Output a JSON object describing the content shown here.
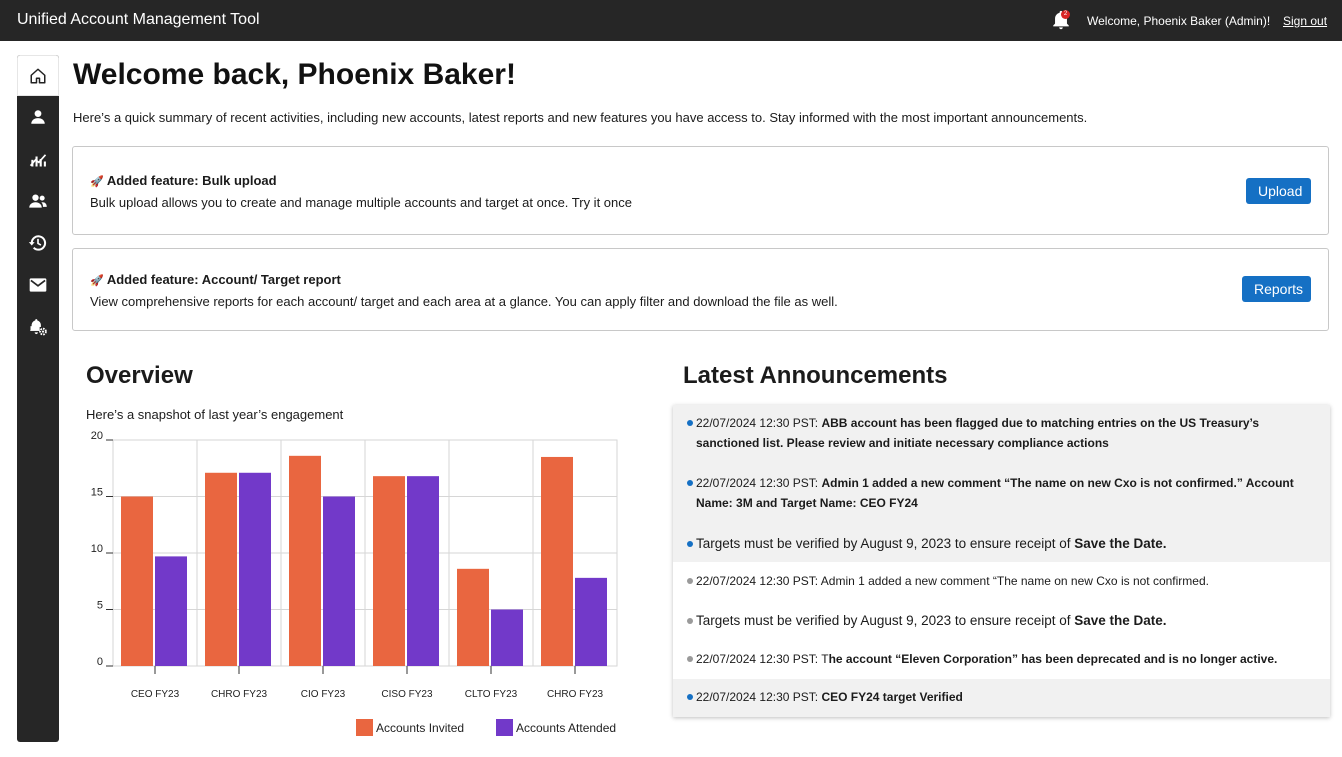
{
  "header": {
    "app_title": "Unified Account Management Tool",
    "notification_count": "2",
    "welcome_text": "Welcome, Phoenix Baker (Admin)!",
    "sign_out_label": "Sign out"
  },
  "sidebar": {
    "items": [
      {
        "icon": "home-icon"
      },
      {
        "icon": "person-icon"
      },
      {
        "icon": "analytics-icon"
      },
      {
        "icon": "group-icon"
      },
      {
        "icon": "history-icon"
      },
      {
        "icon": "mail-icon"
      },
      {
        "icon": "notification-settings-icon"
      }
    ]
  },
  "main": {
    "title": "Welcome back, Phoenix Baker!",
    "intro": "Here’s a quick summary of recent activities, including new accounts, latest reports and new features you have access to. Stay informed with the most important announcements.",
    "features": [
      {
        "icon": "🚀",
        "title": "Added feature: Bulk upload",
        "description": "Bulk upload allows you to create and manage multiple accounts and target at once. Try it once",
        "button_label": "Upload"
      },
      {
        "icon": "🚀",
        "title": "Added feature: Account/ Target report",
        "description": "View comprehensive reports for each account/ target and each area at a glance. You can apply filter and download the file as well.",
        "button_label": "Reports"
      }
    ]
  },
  "overview": {
    "heading": "Overview",
    "subheading": "Here’s a snapshot of last year’s engagement"
  },
  "chart_data": {
    "type": "bar",
    "categories": [
      "CEO FY23",
      "CHRO FY23",
      "CIO FY23",
      "CISO FY23",
      "CLTO FY23",
      "CHRO FY23"
    ],
    "series": [
      {
        "name": "Accounts Invited",
        "values": [
          15,
          17.1,
          18.6,
          16.8,
          8.6,
          18.5
        ]
      },
      {
        "name": "Accounts Attended",
        "values": [
          9.7,
          17.1,
          15,
          16.8,
          5,
          7.8
        ]
      }
    ],
    "colors": [
      "#e96640",
      "#7239c9"
    ],
    "ylim": [
      0,
      20
    ],
    "yticks": [
      0,
      5,
      10,
      15,
      20
    ],
    "grid": true,
    "legend": "bottom-right",
    "title": "",
    "xlabel": "",
    "ylabel": ""
  },
  "announcements": {
    "heading": "Latest Announcements",
    "items": [
      {
        "date": "22/07/2024 12:30 PST:",
        "text": "ABB account has been flagged due to matching entries on the US Treasury’s sanctioned list. Please review and initiate necessary compliance actions",
        "status": "new",
        "size": "small"
      },
      {
        "date": "22/07/2024 12:30 PST:",
        "text": "Admin 1 added a new comment “The name on new Cxo is not confirmed.” Account Name: 3M and Target Name: CEO FY24",
        "status": "new",
        "size": "small"
      },
      {
        "prefix": "Targets must be verified by August 9, 2023 to ensure receipt of ",
        "bold": "Save the Date.",
        "status": "new",
        "size": "large"
      },
      {
        "date": "22/07/2024 12:30 PST:",
        "text": "Admin 1 added a new comment “The name on new Cxo is not confirmed.",
        "status": "read",
        "size": "small"
      },
      {
        "prefix": "Targets must be verified by August 9, 2023 to ensure receipt of ",
        "bold": "Save the Date.",
        "status": "read",
        "size": "large"
      },
      {
        "date": "22/07/2024 12:30 PST:",
        "text_plain": "T",
        "text": "he account “Eleven Corporation” has been deprecated and is no longer active.",
        "status": "read",
        "size": "small"
      },
      {
        "date": "22/07/2024 12:30 PST:",
        "text": "CEO FY24 target Verified",
        "status": "new",
        "size": "small"
      }
    ]
  }
}
